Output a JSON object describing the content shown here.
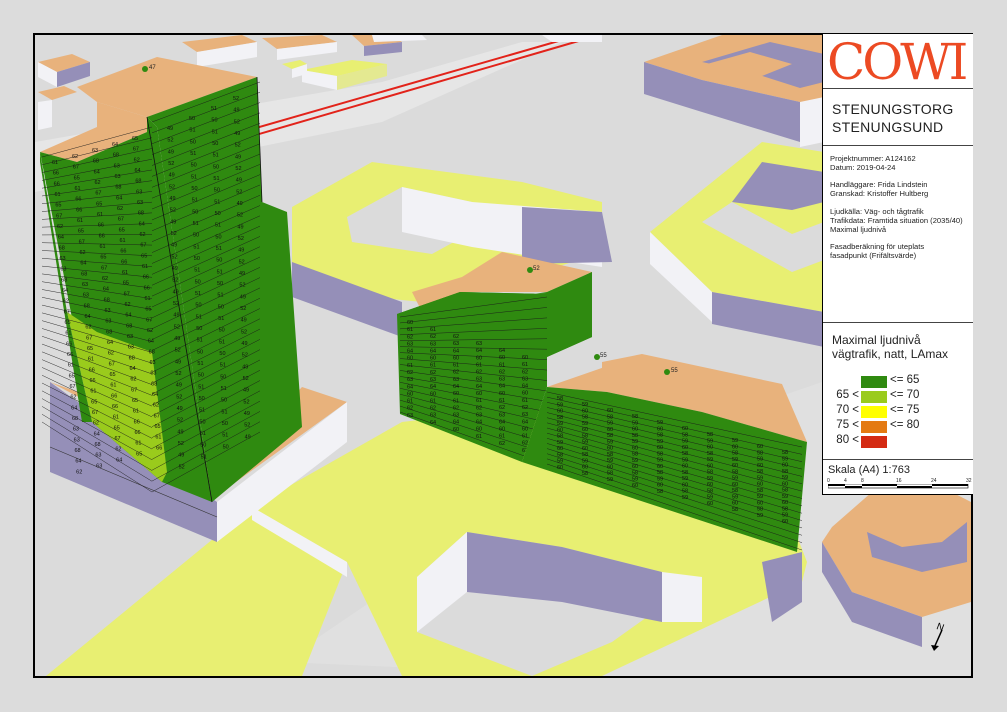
{
  "logo": {
    "text": "COWI",
    "color": "#ec4a23"
  },
  "title": {
    "line1": "STENUNGSTORG",
    "line2": "STENUNGSUND"
  },
  "info": {
    "project_number": "Projektnummer: A124162",
    "date": "Datum: 2019-04-24",
    "handler": "Handläggare: Frida Lindstein",
    "reviewer": "Granskad: Kristoffer Hultberg",
    "source": "Ljudkälla: Väg- och tågtrafik",
    "traffic": "Trafikdata: Framtida situation (2035/40)",
    "level_type": "Maximal ljudnivå",
    "calc1": "Fasadberäkning för uteplats",
    "calc2": "fasadpunkt (Frifältsvärde)"
  },
  "legend": {
    "title1": "Maximal ljudnivå",
    "title2": "vägtrafik, natt, LAmax",
    "classes": [
      {
        "lo": "",
        "hi": "<= 65",
        "color": "#2f8a10"
      },
      {
        "lo": "65 <",
        "hi": "<= 70",
        "color": "#9acb1c"
      },
      {
        "lo": "70 <",
        "hi": "<= 75",
        "color": "#ffff00"
      },
      {
        "lo": "75 <",
        "hi": "<= 80",
        "color": "#e47a12"
      },
      {
        "lo": "80 <",
        "hi": "",
        "color": "#d42a12"
      }
    ]
  },
  "scale": {
    "label": "Skala (A4) 1:763",
    "ticks": [
      "0",
      "4",
      "8",
      "16",
      "24",
      "32"
    ]
  },
  "map": {
    "colors": {
      "ground": "#dbdbdb",
      "roof": "#e8b27c",
      "wall": "#958fb8",
      "wall_light": "#f2f2f6",
      "yellow": "#e8ef72",
      "green": "#2f8a10",
      "lightgreen": "#9acb1c",
      "rail": "#e2231a"
    },
    "facade_point_labels": {
      "tower_front": [
        "61",
        "62",
        "63",
        "64",
        "65",
        "66",
        "67",
        "68"
      ],
      "tower_side": [
        "49",
        "50",
        "51",
        "52"
      ],
      "mid_building": [
        "60",
        "61",
        "62",
        "63",
        "64"
      ],
      "right_building": [
        "58",
        "59",
        "60"
      ],
      "roof_points": [
        "47",
        "52",
        "55",
        "55"
      ]
    }
  }
}
